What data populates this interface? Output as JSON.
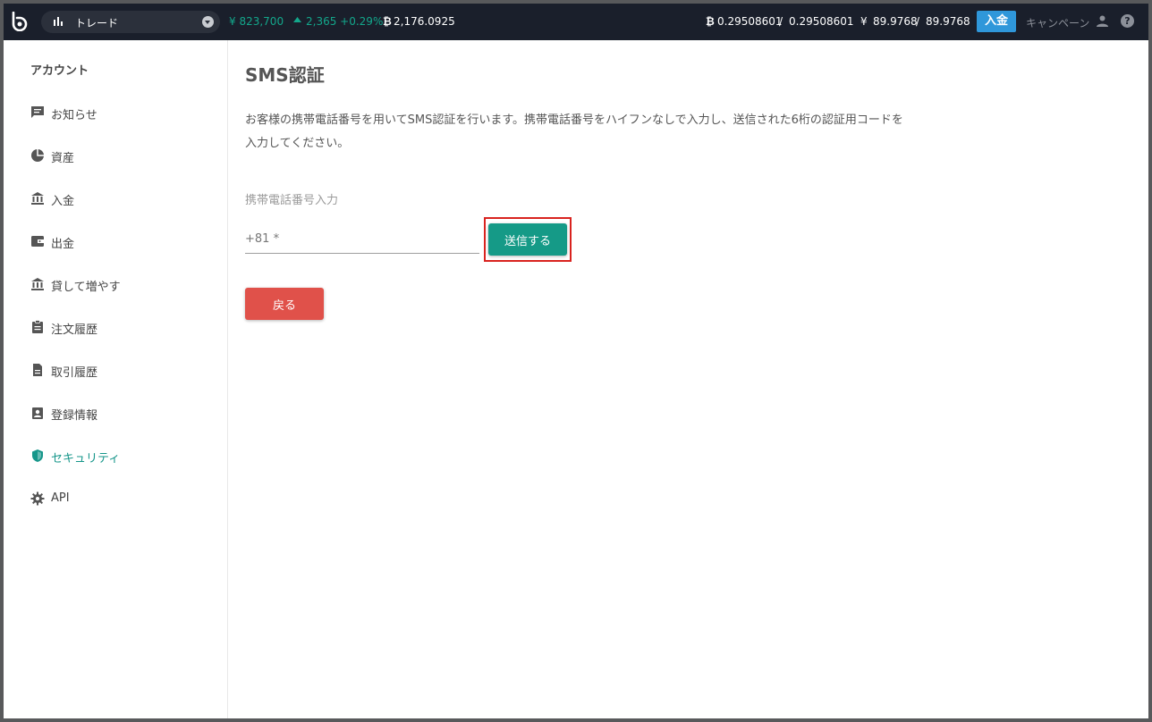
{
  "topbar": {
    "trade_label": "トレード",
    "jpy_price": "¥ 823,700",
    "change": "2,365 +0.29%",
    "btc_value": "2,176.0925",
    "btc_balance": "0.29508601",
    "btc_balance_total": "0.29508601",
    "jpy_balance": "89.9768",
    "jpy_balance_total": "89.9768",
    "deposit_label": "入金",
    "campaign_label": "キャンペーン",
    "help_glyph": "?"
  },
  "sidebar": {
    "title": "アカウント",
    "items": [
      {
        "label": "お知らせ",
        "icon": "message-icon"
      },
      {
        "label": "資産",
        "icon": "pie-chart-icon"
      },
      {
        "label": "入金",
        "icon": "bank-icon"
      },
      {
        "label": "出金",
        "icon": "wallet-icon"
      },
      {
        "label": "貸して増やす",
        "icon": "bank-icon"
      },
      {
        "label": "注文履歴",
        "icon": "clipboard-icon"
      },
      {
        "label": "取引履歴",
        "icon": "document-icon"
      },
      {
        "label": "登録情報",
        "icon": "contact-icon"
      },
      {
        "label": "セキュリティ",
        "icon": "shield-icon",
        "active": true
      },
      {
        "label": "API",
        "icon": "gear-icon"
      }
    ]
  },
  "main": {
    "title": "SMS認証",
    "description": "お客様の携帯電話番号を用いてSMS認証を行います。携帯電話番号をハイフンなしで入力し、送信された6桁の認証用コードを入力してください。",
    "field_label": "携帯電話番号入力",
    "phone_placeholder": "+81 *",
    "send_label": "送信する",
    "back_label": "戻る"
  },
  "colors": {
    "topbar_bg": "#1a1f2b",
    "accent_green": "#13a78b",
    "send_button": "#159a87",
    "back_button": "#e0514a",
    "deposit_button": "#2f97da",
    "highlight_border": "#d9231f"
  }
}
